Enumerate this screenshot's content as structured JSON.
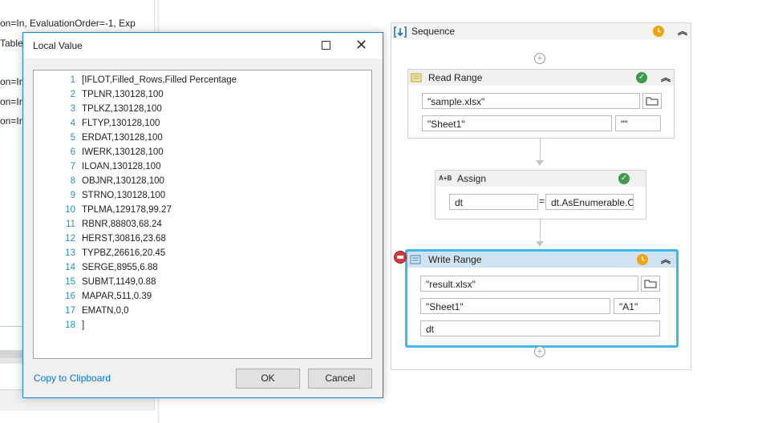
{
  "left_panel": {
    "lines": [
      "on=In, EvaluationOrder=-1, Exp",
      "Table}",
      "on=In",
      "on=In",
      "on=In"
    ]
  },
  "dialog": {
    "title": "Local Value",
    "line_numbers": [
      "1",
      "2",
      "3",
      "4",
      "5",
      "6",
      "7",
      "8",
      "9",
      "10",
      "11",
      "12",
      "13",
      "14",
      "15",
      "16",
      "17",
      "18"
    ],
    "lines": [
      "[IFLOT,Filled_Rows,Filled Percentage",
      "TPLNR,130128,100",
      "TPLKZ,130128,100",
      "FLTYP,130128,100",
      "ERDAT,130128,100",
      "IWERK,130128,100",
      "ILOAN,130128,100",
      "OBJNR,130128,100",
      "STRNO,130128,100",
      "TPLMA,129178,99.27",
      "RBNR,88803,68.24",
      "HERST,30816,23.68",
      "TYPBZ,26616,20.45",
      "SERGE,8955,6.88",
      "SUBMT,1149,0.88",
      "MAPAR,511,0.39",
      "EMATN,0,0",
      "]"
    ],
    "copy_link": "Copy to Clipboard",
    "ok_label": "OK",
    "cancel_label": "Cancel"
  },
  "designer": {
    "sequence_title": "Sequence",
    "read_range": {
      "title": "Read Range",
      "path": "\"sample.xlsx\"",
      "sheet": "\"Sheet1\"",
      "range": "\"\""
    },
    "assign": {
      "title": "Assign",
      "icon_text": "A+B",
      "to": "dt",
      "equals": "=",
      "value": "dt.AsEnumerable.C"
    },
    "write_range": {
      "title": "Write Range",
      "path": "\"result.xlsx\"",
      "sheet": "\"Sheet1\"",
      "start_cell": "\"A1\"",
      "datatable": "dt"
    }
  },
  "colors": {
    "accent": "#1883d7",
    "selected_border": "#3cb9ec",
    "warning": "#f0a30a",
    "success": "#3c9a4a",
    "link": "#0078d7"
  }
}
